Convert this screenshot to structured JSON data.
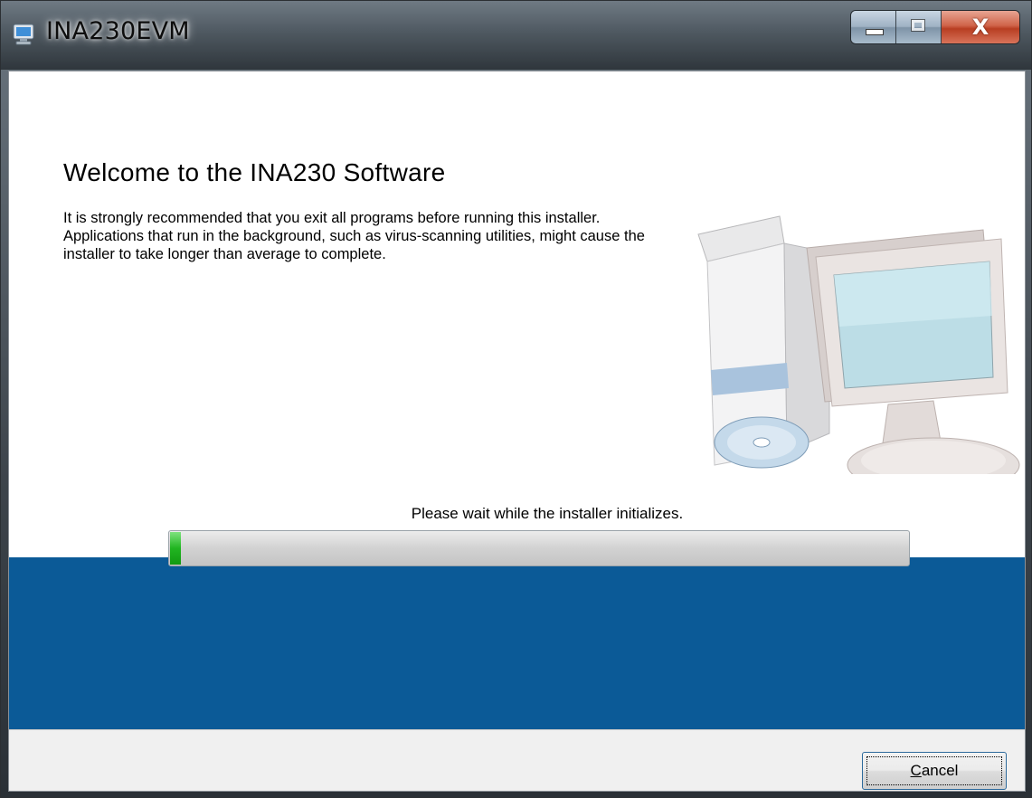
{
  "window": {
    "title": "INA230EVM",
    "icons": {
      "app": "installer-computer-icon",
      "minimize": "minimize-icon",
      "maximize": "maximize-icon",
      "close": "close-icon"
    },
    "close_glyph": "X"
  },
  "welcome": {
    "title": "Welcome to the INA230 Software",
    "body": "It is strongly recommended that you exit all programs before running this installer. Applications that run in the background, such as virus-scanning utilities, might cause the installer to take longer than average to complete.",
    "illustration": "computer-with-cd-illustration"
  },
  "progress": {
    "status": "Please wait while the installer initializes.",
    "fraction": 0.015
  },
  "footer": {
    "cancel_label": "Cancel",
    "cancel_access_key": "C",
    "cancel_rest": "ancel"
  },
  "colors": {
    "band": "#0b5a97",
    "progress_green": "#21b521"
  }
}
